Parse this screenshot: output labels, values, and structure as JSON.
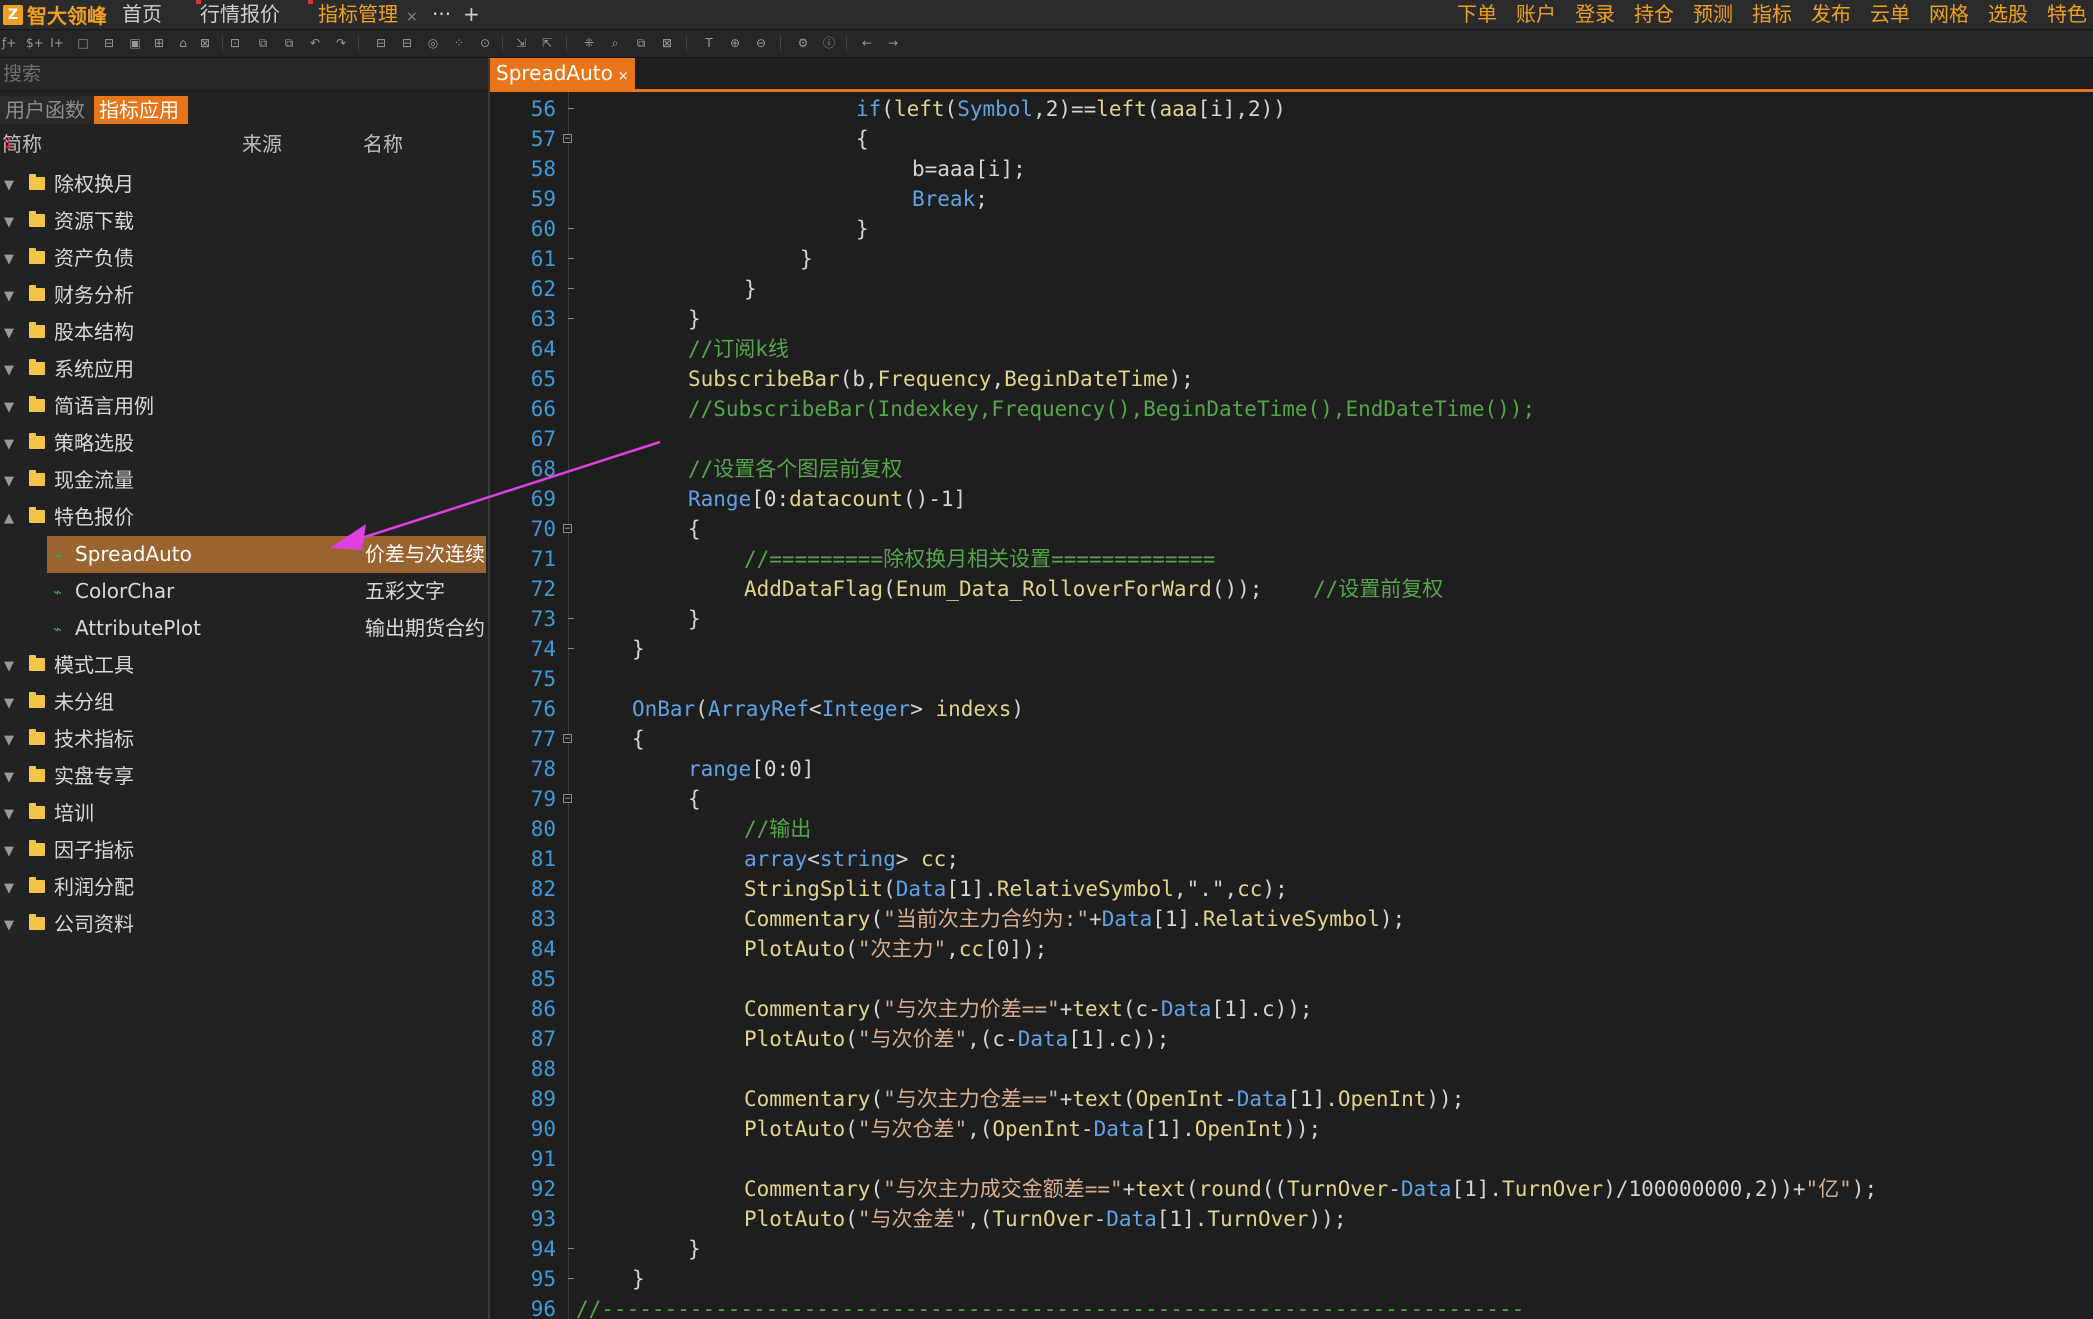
{
  "app": {
    "logo_mark": "Z",
    "logo_name": "智大领峰"
  },
  "tabs": [
    {
      "label": "首页"
    },
    {
      "label": "行情报价"
    },
    {
      "label": "指标管理",
      "active": true,
      "close": "×"
    },
    {
      "label": "···"
    },
    {
      "label": "+"
    }
  ],
  "top_menu": [
    "下单",
    "账户",
    "登录",
    "持仓",
    "预测",
    "指标",
    "发布",
    "云单",
    "网格",
    "选股",
    "特色"
  ],
  "left": {
    "search_placeholder": "搜索",
    "subtabs": [
      "用户函数",
      "指标应用"
    ],
    "columns": {
      "abbr": "简称",
      "sort_mark": "↓",
      "source": "来源",
      "name": "名称"
    },
    "tree": [
      {
        "label": "除权换月",
        "expanded": false
      },
      {
        "label": "资源下载",
        "expanded": false
      },
      {
        "label": "资产负债",
        "expanded": false
      },
      {
        "label": "财务分析",
        "expanded": false
      },
      {
        "label": "股本结构",
        "expanded": false
      },
      {
        "label": "系统应用",
        "expanded": false
      },
      {
        "label": "简语言用例",
        "expanded": false
      },
      {
        "label": "策略选股",
        "expanded": false
      },
      {
        "label": "现金流量",
        "expanded": false
      },
      {
        "label": "特色报价",
        "expanded": true
      },
      {
        "label": "SpreadAuto",
        "child": true,
        "selected": true,
        "desc": "价差与次连续"
      },
      {
        "label": "ColorChar",
        "child": true,
        "desc": "五彩文字"
      },
      {
        "label": "AttributePlot",
        "child": true,
        "desc": "输出期货合约"
      },
      {
        "label": "模式工具",
        "expanded": false
      },
      {
        "label": "未分组",
        "expanded": false
      },
      {
        "label": "技术指标",
        "expanded": false
      },
      {
        "label": "实盘专享",
        "expanded": false
      },
      {
        "label": "培训",
        "expanded": false
      },
      {
        "label": "因子指标",
        "expanded": false
      },
      {
        "label": "利润分配",
        "expanded": false
      },
      {
        "label": "公司资料",
        "expanded": false
      }
    ]
  },
  "editor": {
    "tab_label": "SpreadAuto",
    "tab_close": "×",
    "colors": {
      "keyword": "#5fa3e6",
      "function": "#e3d28a",
      "comment": "#55a64a",
      "string": "#d7ad8e",
      "accent": "#e9751b",
      "arrow": "#e040e0"
    },
    "lines": [
      {
        "n": "56",
        "fold": "tick",
        "indent": 5,
        "tokens": [
          [
            "if",
            "blue"
          ],
          [
            "(",
            "w"
          ],
          [
            "left",
            "yel"
          ],
          [
            "(",
            "w"
          ],
          [
            "Symbol",
            "blue"
          ],
          [
            ",2)==",
            "w"
          ],
          [
            "left",
            "yel"
          ],
          [
            "(",
            "w"
          ],
          [
            "aaa",
            "yel"
          ],
          [
            "[i],2))",
            "w"
          ]
        ]
      },
      {
        "n": "57",
        "fold": "box",
        "indent": 5,
        "tokens": [
          [
            "{",
            "w"
          ]
        ]
      },
      {
        "n": "58",
        "fold": "line",
        "indent": 6,
        "tokens": [
          [
            "b=aaa[i];",
            "w"
          ]
        ]
      },
      {
        "n": "59",
        "fold": "line",
        "indent": 6,
        "tokens": [
          [
            "Break",
            "blue"
          ],
          [
            ";",
            "w"
          ]
        ]
      },
      {
        "n": "60",
        "fold": "tick",
        "indent": 5,
        "tokens": [
          [
            "}",
            "w"
          ]
        ]
      },
      {
        "n": "61",
        "fold": "tick",
        "indent": 4,
        "tokens": [
          [
            "}",
            "w"
          ]
        ]
      },
      {
        "n": "62",
        "fold": "tick",
        "indent": 3,
        "tokens": [
          [
            "}",
            "w"
          ]
        ]
      },
      {
        "n": "63",
        "fold": "tick",
        "indent": 2,
        "tokens": [
          [
            "}",
            "w"
          ]
        ]
      },
      {
        "n": "64",
        "fold": "line",
        "indent": 2,
        "tokens": [
          [
            "//订阅k线",
            "green"
          ]
        ]
      },
      {
        "n": "65",
        "fold": "line",
        "indent": 2,
        "tokens": [
          [
            "SubscribeBar",
            "yel"
          ],
          [
            "(b,",
            "w"
          ],
          [
            "Frequency",
            "yel"
          ],
          [
            ",",
            "w"
          ],
          [
            "BeginDateTime",
            "yel"
          ],
          [
            ");",
            "w"
          ]
        ]
      },
      {
        "n": "66",
        "fold": "line",
        "indent": 2,
        "tokens": [
          [
            "//SubscribeBar(Indexkey,Frequency(),BeginDateTime(),EndDateTime());",
            "green"
          ]
        ]
      },
      {
        "n": "67",
        "fold": "line",
        "indent": 0,
        "tokens": []
      },
      {
        "n": "68",
        "fold": "line",
        "indent": 2,
        "tokens": [
          [
            "//设置各个图层前复权",
            "green"
          ]
        ]
      },
      {
        "n": "69",
        "fold": "line",
        "indent": 2,
        "tokens": [
          [
            "Range",
            "blue"
          ],
          [
            "[0:",
            "w"
          ],
          [
            "datacount",
            "yel"
          ],
          [
            "()-1]",
            "w"
          ]
        ]
      },
      {
        "n": "70",
        "fold": "box",
        "indent": 2,
        "tokens": [
          [
            "{",
            "w"
          ]
        ]
      },
      {
        "n": "71",
        "fold": "line",
        "indent": 3,
        "tokens": [
          [
            "//=========除权换月相关设置=============",
            "green"
          ]
        ]
      },
      {
        "n": "72",
        "fold": "line",
        "indent": 3,
        "tokens": [
          [
            "AddDataFlag",
            "yel"
          ],
          [
            "(",
            "w"
          ],
          [
            "Enum_Data_RolloverForWard",
            "yel"
          ],
          [
            "());    ",
            "w"
          ],
          [
            "//设置前复权",
            "green"
          ]
        ]
      },
      {
        "n": "73",
        "fold": "tick",
        "indent": 2,
        "tokens": [
          [
            "}",
            "w"
          ]
        ]
      },
      {
        "n": "74",
        "fold": "end",
        "indent": 1,
        "tokens": [
          [
            "}",
            "w"
          ]
        ]
      },
      {
        "n": "75",
        "fold": "none",
        "indent": 0,
        "tokens": []
      },
      {
        "n": "76",
        "fold": "none",
        "indent": 1,
        "tokens": [
          [
            "OnBar",
            "blue"
          ],
          [
            "(",
            "w"
          ],
          [
            "ArrayRef",
            "blue"
          ],
          [
            "<",
            "w"
          ],
          [
            "Integer",
            "blue"
          ],
          [
            "> ",
            "w"
          ],
          [
            "indexs",
            "yel"
          ],
          [
            ")",
            "w"
          ]
        ]
      },
      {
        "n": "77",
        "fold": "box",
        "indent": 1,
        "tokens": [
          [
            "{",
            "w"
          ]
        ]
      },
      {
        "n": "78",
        "fold": "line",
        "indent": 2,
        "tokens": [
          [
            "range",
            "blue"
          ],
          [
            "[0:0]",
            "w"
          ]
        ]
      },
      {
        "n": "79",
        "fold": "box",
        "indent": 2,
        "tokens": [
          [
            "{",
            "w"
          ]
        ]
      },
      {
        "n": "80",
        "fold": "line",
        "indent": 3,
        "tokens": [
          [
            "//输出",
            "green"
          ]
        ]
      },
      {
        "n": "81",
        "fold": "line",
        "indent": 3,
        "tokens": [
          [
            "array",
            "blue"
          ],
          [
            "<",
            "w"
          ],
          [
            "string",
            "blue"
          ],
          [
            "> ",
            "w"
          ],
          [
            "cc",
            "yel"
          ],
          [
            ";",
            "w"
          ]
        ]
      },
      {
        "n": "82",
        "fold": "line",
        "indent": 3,
        "tokens": [
          [
            "StringSplit",
            "yel"
          ],
          [
            "(",
            "w"
          ],
          [
            "Data",
            "blue"
          ],
          [
            "[1].",
            "w"
          ],
          [
            "RelativeSymbol",
            "yel"
          ],
          [
            ",\".\",",
            "w"
          ],
          [
            "cc",
            "yel"
          ],
          [
            ");",
            "w"
          ]
        ]
      },
      {
        "n": "83",
        "fold": "line",
        "indent": 3,
        "tokens": [
          [
            "Commentary",
            "yel"
          ],
          [
            "(",
            "w"
          ],
          [
            "\"当前次主力合约为:\"",
            "str"
          ],
          [
            "+",
            "w"
          ],
          [
            "Data",
            "blue"
          ],
          [
            "[1].",
            "w"
          ],
          [
            "RelativeSymbol",
            "yel"
          ],
          [
            ");",
            "w"
          ]
        ]
      },
      {
        "n": "84",
        "fold": "line",
        "indent": 3,
        "tokens": [
          [
            "PlotAuto",
            "yel"
          ],
          [
            "(",
            "w"
          ],
          [
            "\"次主力\"",
            "str"
          ],
          [
            ",",
            "w"
          ],
          [
            "cc",
            "yel"
          ],
          [
            "[0]);",
            "w"
          ]
        ]
      },
      {
        "n": "85",
        "fold": "line",
        "indent": 0,
        "tokens": []
      },
      {
        "n": "86",
        "fold": "line",
        "indent": 3,
        "tokens": [
          [
            "Commentary",
            "yel"
          ],
          [
            "(",
            "w"
          ],
          [
            "\"与次主力价差==\"",
            "str"
          ],
          [
            "+",
            "w"
          ],
          [
            "text",
            "yel"
          ],
          [
            "(c-",
            "w"
          ],
          [
            "Data",
            "blue"
          ],
          [
            "[1].c));",
            "w"
          ]
        ]
      },
      {
        "n": "87",
        "fold": "line",
        "indent": 3,
        "tokens": [
          [
            "PlotAuto",
            "yel"
          ],
          [
            "(",
            "w"
          ],
          [
            "\"与次价差\"",
            "str"
          ],
          [
            ",(c-",
            "w"
          ],
          [
            "Data",
            "blue"
          ],
          [
            "[1].c));",
            "w"
          ]
        ]
      },
      {
        "n": "88",
        "fold": "line",
        "indent": 0,
        "tokens": []
      },
      {
        "n": "89",
        "fold": "line",
        "indent": 3,
        "tokens": [
          [
            "Commentary",
            "yel"
          ],
          [
            "(",
            "w"
          ],
          [
            "\"与次主力仓差==\"",
            "str"
          ],
          [
            "+",
            "w"
          ],
          [
            "text",
            "yel"
          ],
          [
            "(",
            "w"
          ],
          [
            "OpenInt",
            "yel"
          ],
          [
            "-",
            "w"
          ],
          [
            "Data",
            "blue"
          ],
          [
            "[1].",
            "w"
          ],
          [
            "OpenInt",
            "yel"
          ],
          [
            "));",
            "w"
          ]
        ]
      },
      {
        "n": "90",
        "fold": "line",
        "indent": 3,
        "tokens": [
          [
            "PlotAuto",
            "yel"
          ],
          [
            "(",
            "w"
          ],
          [
            "\"与次仓差\"",
            "str"
          ],
          [
            ",(",
            "w"
          ],
          [
            "OpenInt",
            "yel"
          ],
          [
            "-",
            "w"
          ],
          [
            "Data",
            "blue"
          ],
          [
            "[1].",
            "w"
          ],
          [
            "OpenInt",
            "yel"
          ],
          [
            "));",
            "w"
          ]
        ]
      },
      {
        "n": "91",
        "fold": "line",
        "indent": 0,
        "tokens": []
      },
      {
        "n": "92",
        "fold": "line",
        "indent": 3,
        "tokens": [
          [
            "Commentary",
            "yel"
          ],
          [
            "(",
            "w"
          ],
          [
            "\"与次主力成交金额差==\"",
            "str"
          ],
          [
            "+",
            "w"
          ],
          [
            "text",
            "yel"
          ],
          [
            "(",
            "w"
          ],
          [
            "round",
            "yel"
          ],
          [
            "((",
            "w"
          ],
          [
            "TurnOver",
            "yel"
          ],
          [
            "-",
            "w"
          ],
          [
            "Data",
            "blue"
          ],
          [
            "[1].",
            "w"
          ],
          [
            "TurnOver",
            "yel"
          ],
          [
            ")/100000000,2))+",
            "w"
          ],
          [
            "\"亿\"",
            "str"
          ],
          [
            ");",
            "w"
          ]
        ]
      },
      {
        "n": "93",
        "fold": "line",
        "indent": 3,
        "tokens": [
          [
            "PlotAuto",
            "yel"
          ],
          [
            "(",
            "w"
          ],
          [
            "\"与次金差\"",
            "str"
          ],
          [
            ",(",
            "w"
          ],
          [
            "TurnOver",
            "yel"
          ],
          [
            "-",
            "w"
          ],
          [
            "Data",
            "blue"
          ],
          [
            "[1].",
            "w"
          ],
          [
            "TurnOver",
            "yel"
          ],
          [
            "));",
            "w"
          ]
        ]
      },
      {
        "n": "94",
        "fold": "end",
        "indent": 2,
        "tokens": [
          [
            "}",
            "w"
          ]
        ]
      },
      {
        "n": "95",
        "fold": "end",
        "indent": 1,
        "tokens": [
          [
            "}",
            "w"
          ]
        ]
      },
      {
        "n": "96",
        "fold": "none",
        "indent": 0,
        "tokens": [
          [
            "//-------------------------------------------------------------------------",
            "green"
          ]
        ]
      }
    ]
  }
}
